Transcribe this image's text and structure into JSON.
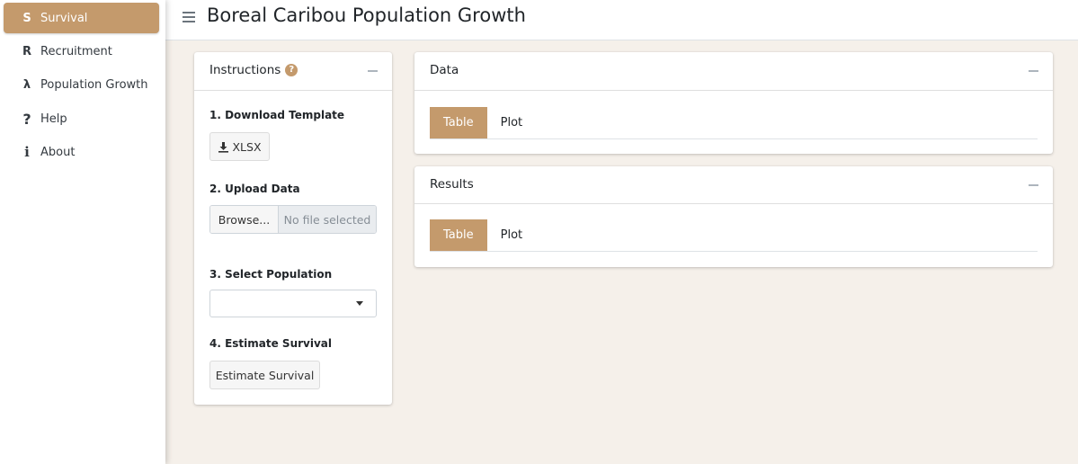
{
  "app": {
    "title": "Boreal Caribou Population Growth"
  },
  "sidebar": {
    "items": [
      {
        "icon": "S",
        "label": "Survival",
        "active": true
      },
      {
        "icon": "R",
        "label": "Recruitment",
        "active": false
      },
      {
        "icon": "λ",
        "label": "Population Growth",
        "active": false
      },
      {
        "icon": "?",
        "label": "Help",
        "active": false
      },
      {
        "icon": "i",
        "label": "About",
        "active": false
      }
    ]
  },
  "instructions": {
    "title": "Instructions",
    "help_icon": "?",
    "step1_label": "1. Download Template",
    "download_button": "XLSX",
    "step2_label": "2. Upload Data",
    "browse_button": "Browse...",
    "file_status": "No file selected",
    "step3_label": "3. Select Population",
    "population_value": "",
    "step4_label": "4. Estimate Survival",
    "estimate_button": "Estimate Survival"
  },
  "data_panel": {
    "title": "Data",
    "tabs": [
      {
        "label": "Table",
        "active": true
      },
      {
        "label": "Plot",
        "active": false
      }
    ]
  },
  "results_panel": {
    "title": "Results",
    "tabs": [
      {
        "label": "Table",
        "active": true
      },
      {
        "label": "Plot",
        "active": false
      }
    ]
  },
  "colors": {
    "accent": "#c49a6c",
    "background": "#f5f0ea"
  }
}
